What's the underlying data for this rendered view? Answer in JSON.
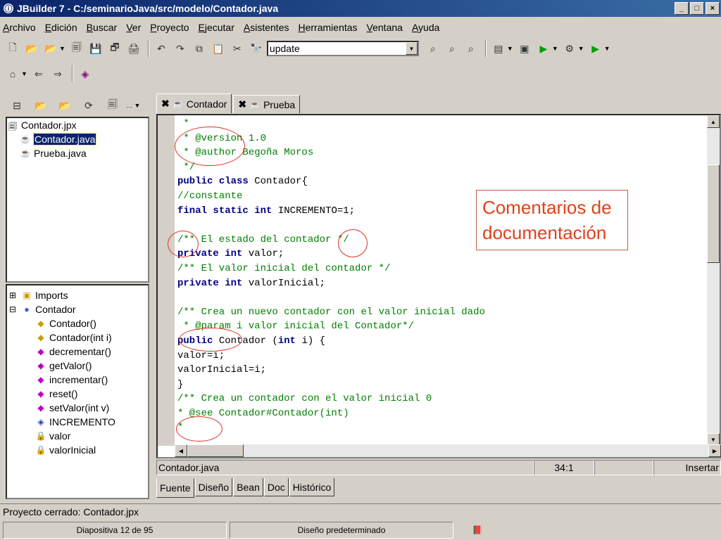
{
  "window": {
    "title": "JBuilder 7 - C:/seminarioJava/src/modelo/Contador.java",
    "buttons": [
      "_",
      "□",
      "×"
    ]
  },
  "menu": [
    "Archivo",
    "Edición",
    "Buscar",
    "Ver",
    "Proyecto",
    "Ejecutar",
    "Asistentes",
    "Herramientas",
    "Ventana",
    "Ayuda"
  ],
  "toolbar": {
    "search_value": "update"
  },
  "project_tree": {
    "root": "Contador.jpx",
    "files": [
      "Contador.java",
      "Prueba.java"
    ]
  },
  "structure_tree": {
    "imports": "Imports",
    "class": "Contador",
    "members": [
      "Contador()",
      "Contador(int i)",
      "decrementar()",
      "getValor()",
      "incrementar()",
      "reset()",
      "setValor(int v)",
      "INCREMENTO",
      "valor",
      "valorInicial"
    ]
  },
  "editor_tabs": [
    "Contador",
    "Prueba"
  ],
  "code_lines": [
    " *",
    " * @version 1.0",
    " * @author Begoña Moros",
    " */",
    "public class Contador{",
    "//constante",
    "final static int INCREMENTO=1;",
    "",
    "/** El estado del contador */",
    "private int valor;",
    "/** El valor inicial del contador */",
    "private int valorInicial;",
    "",
    "/** Crea un nuevo contador con el valor inicial dado",
    " * @param i valor inicial del Contador*/",
    "public Contador (int i) {",
    "valor=i;",
    "valorInicial=i;",
    "}",
    "/** Crea un contador con el valor inicial 0",
    "* @see Contador#Contador(int)",
    "*"
  ],
  "annotation": {
    "line1": "Comentarios de",
    "line2": "documentación"
  },
  "editor_status": {
    "file": "Contador.java",
    "position": "34:1",
    "mode": "Insertar"
  },
  "bottom_tabs": [
    "Fuente",
    "Diseño",
    "Bean",
    "Doc",
    "Histórico"
  ],
  "status_message": "Proyecto cerrado: Contador.jpx",
  "ppt_status": {
    "slide": "Diapositiva 12 de 95",
    "design": "Diseño predeterminado"
  }
}
